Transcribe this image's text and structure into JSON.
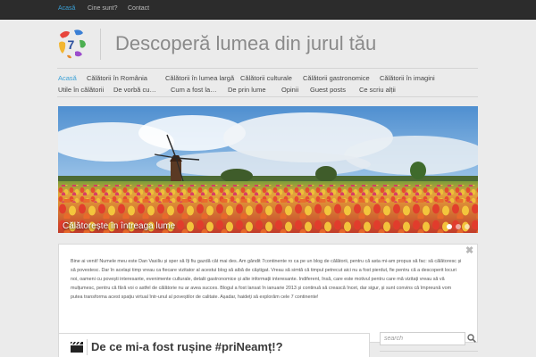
{
  "topbar": {
    "links": [
      "Acasă",
      "Cine sunt?",
      "Contact"
    ]
  },
  "header": {
    "title": "Descoperă lumea din jurul tău",
    "logo_number": "7"
  },
  "nav": {
    "row1": [
      "Acasă",
      "Călătorii în România",
      "Călătorii în lumea largă",
      "Călătorii culturale",
      "Călătorii gastronomice",
      "Călătorii în imagini"
    ],
    "row2": [
      "Utile în călătorii",
      "De vorbă cu…",
      "Cum a fost la…",
      "De prin lume",
      "Opinii",
      "Guest posts",
      "Ce scriu alții"
    ]
  },
  "slider": {
    "caption": "Călătorește în întreaga lume",
    "slide_count": 3,
    "active_slide": 1
  },
  "intro": {
    "text": "Bine ai venit! Numele meu este Dan Vasiliu și sper să îți fiu gazdă cât mai des. Am gândit 7continente ro ca pe un blog de călătorii, pentru că asta mi-am propus să fac: să călătoresc și să povestesc. Dar în același timp vreau ca fiecare vizitator al acestui blog să aibă de câștigat. Vreau să simtă că timpul petrecut aici nu a fost pierdut, fie pentru că a descoperit locuri noi, oameni cu povești interesante, evenimente culturale, detalii gastronomice și alte informații interesante. Indiferent, însă, care este motivul pentru care mă vizitați vreau să vă mulțumesc, pentru că fără voi o astfel de călătorie nu ar avea succes. Blogul a fost lansat în ianuarie 2013 și continuă să crească încet, dar sigur, și sunt convins că împreună vom putea transforma acest spațiu virtual într-unul al poveștilor de calitate. Așadar, haideți să explorăm cele 7 continente!",
    "close_symbol": "✖"
  },
  "post": {
    "title": "De ce mi-a fost rușine #priNeamț!?",
    "icon": "clapperboard-icon"
  },
  "search": {
    "placeholder": "search",
    "icon": "search-icon"
  },
  "colors": {
    "accent": "#3aa0d6",
    "topbar": "#2c2c2c",
    "background": "#ebebeb"
  }
}
